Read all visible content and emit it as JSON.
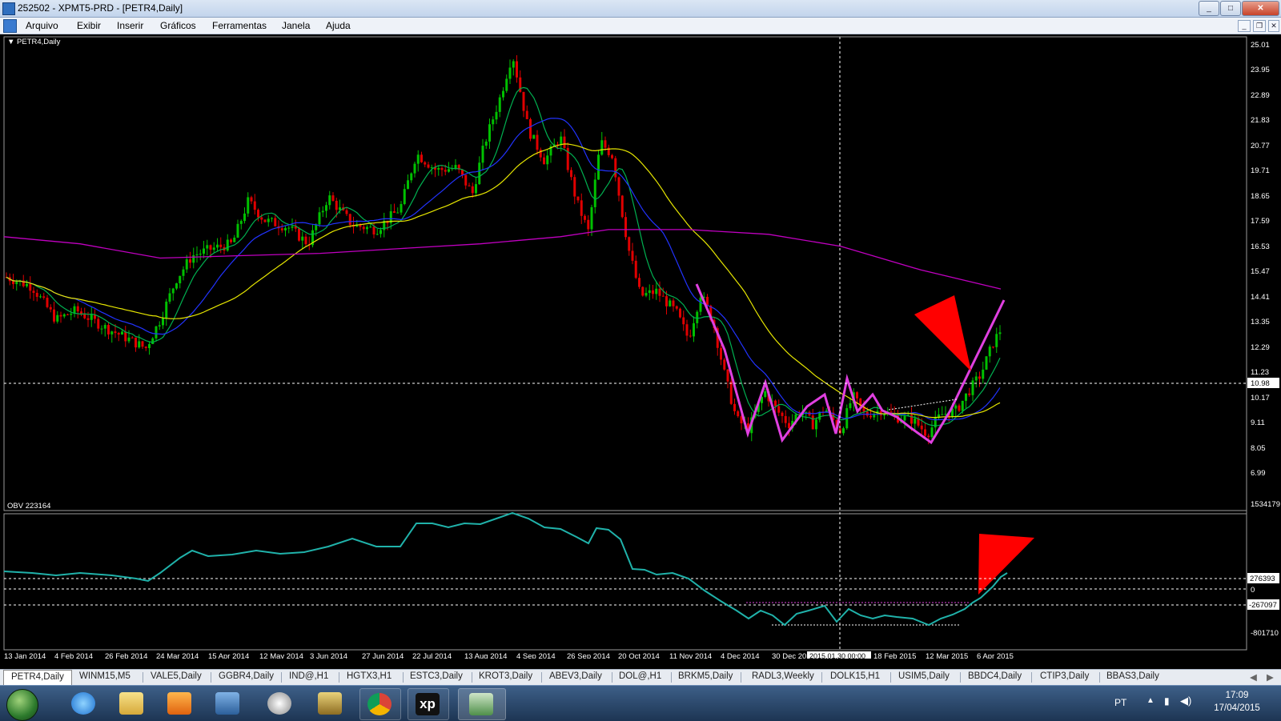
{
  "window": {
    "title": "252502 - XPMT5-PRD - [PETR4,Daily]",
    "controls": [
      "_",
      "□",
      "✕"
    ]
  },
  "menu": {
    "items": [
      "Arquivo",
      "Exibir",
      "Inserir",
      "Gráficos",
      "Ferramentas",
      "Janela",
      "Ajuda"
    ],
    "mdi_controls": [
      "_",
      "❐",
      "✕"
    ]
  },
  "chart": {
    "main_label": "▼ PETR4,Daily",
    "obv_label": "OBV 223164",
    "price_axis": [
      "25.01",
      "23.95",
      "22.89",
      "21.83",
      "20.77",
      "19.71",
      "18.65",
      "17.59",
      "16.53",
      "15.47",
      "14.41",
      "13.35",
      "12.29",
      "11.23",
      "10.17",
      "9.11",
      "8.05",
      "6.99"
    ],
    "current_price": "10.98",
    "obv_axis": [
      "1534179",
      "276393",
      "0",
      "-267097",
      "-801710"
    ],
    "dates": [
      "13 Jan 2014",
      "4 Feb 2014",
      "26 Feb 2014",
      "24 Mar 2014",
      "15 Apr 2014",
      "12 May 2014",
      "3 Jun 2014",
      "27 Jun 2014",
      "22 Jul 2014",
      "13 Aug 2014",
      "4 Sep 2014",
      "26 Sep 2014",
      "20 Oct 2014",
      "11 Nov 2014",
      "4 Dec 2014",
      "30 Dec 2014",
      "2015.01.30 00:00",
      "18 Feb 2015",
      "12 Mar 2015",
      "6 Apr 2015"
    ],
    "colors": {
      "background": "#000000",
      "up_candle": "#00c000",
      "down_candle": "#e00000",
      "ma_fast": "#00b050",
      "ma_mid": "#2233ff",
      "ma_slow": "#e6e600",
      "ma_long": "#c000c0",
      "obv": "#20b2aa",
      "pattern": "#e040e0",
      "arrows": "#ff0000",
      "grid_text": "#ffffff"
    }
  },
  "tabs": {
    "active": "PETR4,Daily",
    "items": [
      "PETR4,Daily",
      "WINM15,M5",
      "VALE5,Daily",
      "GGBR4,Daily",
      "IND@,H1",
      "HGTX3,H1",
      "ESTC3,Daily",
      "KROT3,Daily",
      "ABEV3,Daily",
      "DOL@,H1",
      "BRKM5,Daily",
      "RADL3,Weekly",
      "DOLK15,H1",
      "USIM5,Daily",
      "BBDC4,Daily",
      "CTIP3,Daily",
      "BBAS3,Daily"
    ]
  },
  "taskbar": {
    "apps": [
      "windows-start-icon",
      "internet-explorer-icon",
      "file-explorer-icon",
      "media-player-icon",
      "remote-app-icon",
      "hp-icon",
      "archive-icon",
      "chrome-icon",
      "xp-icon",
      "metatrader-icon"
    ],
    "xp_label": "xp",
    "language": "PT",
    "time": "17:09",
    "date": "17/04/2015"
  }
}
